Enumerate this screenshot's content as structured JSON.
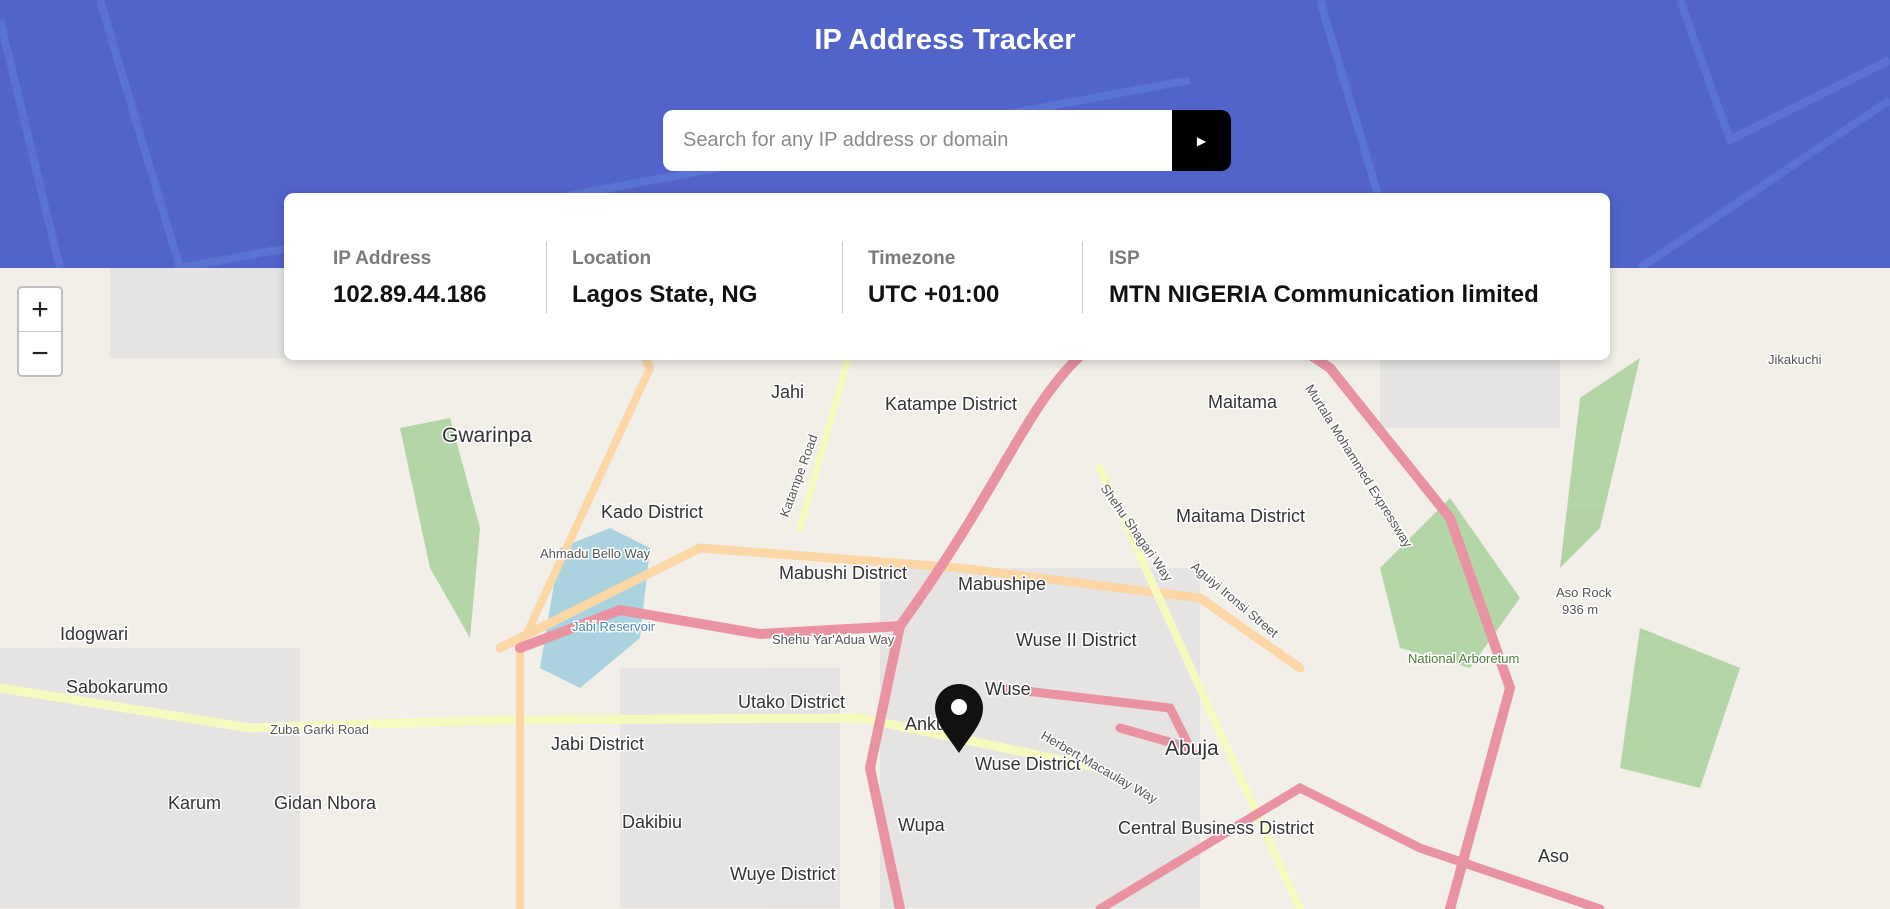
{
  "header": {
    "title": "IP Address Tracker"
  },
  "search": {
    "placeholder": "Search for any IP address or domain",
    "value": "",
    "submit_icon": "chevron-right-icon"
  },
  "info": [
    {
      "label": "IP Address",
      "value": "102.89.44.186"
    },
    {
      "label": "Location",
      "value": "Lagos State, NG"
    },
    {
      "label": "Timezone",
      "value": "UTC +01:00"
    },
    {
      "label": "ISP",
      "value": "MTN NIGERIA Communication limited"
    }
  ],
  "map": {
    "zoom_in": "+",
    "zoom_out": "−",
    "places": [
      "Jahi",
      "Katampe District",
      "Maitama",
      "Jikakuchi",
      "Gwarinpa",
      "Kado District",
      "Maitama District",
      "Mabushi District",
      "Mabushipe",
      "Wuse II District",
      "Idogwari",
      "Jabi Reservoir",
      "Aso Rock",
      "936 m",
      "National Arboretum",
      "Sabokarumo",
      "Utako District",
      "Wuse",
      "Jabi District",
      "Abuja",
      "Ankuru",
      "Wuse District",
      "Karum",
      "Gidan Nbora",
      "Dakibiu",
      "Wupa",
      "Central Business District",
      "Wuye District",
      "Aso"
    ],
    "roads": [
      "Ahmadu Bello Way",
      "Shehu Yar'Adua Way",
      "Zuba Garki Road",
      "Katampe Road",
      "Herbert Macaulay Way",
      "Shehu Shagari Way",
      "Murtala Mohammed Expressway",
      "Aguiyi Ironsi Street"
    ],
    "colors": {
      "motorway": "#e892a2",
      "primary": "#fcd6a4",
      "secondary": "#f7fabf",
      "water": "#aad3df",
      "park": "#add19e",
      "land": "#f2efe9"
    }
  }
}
